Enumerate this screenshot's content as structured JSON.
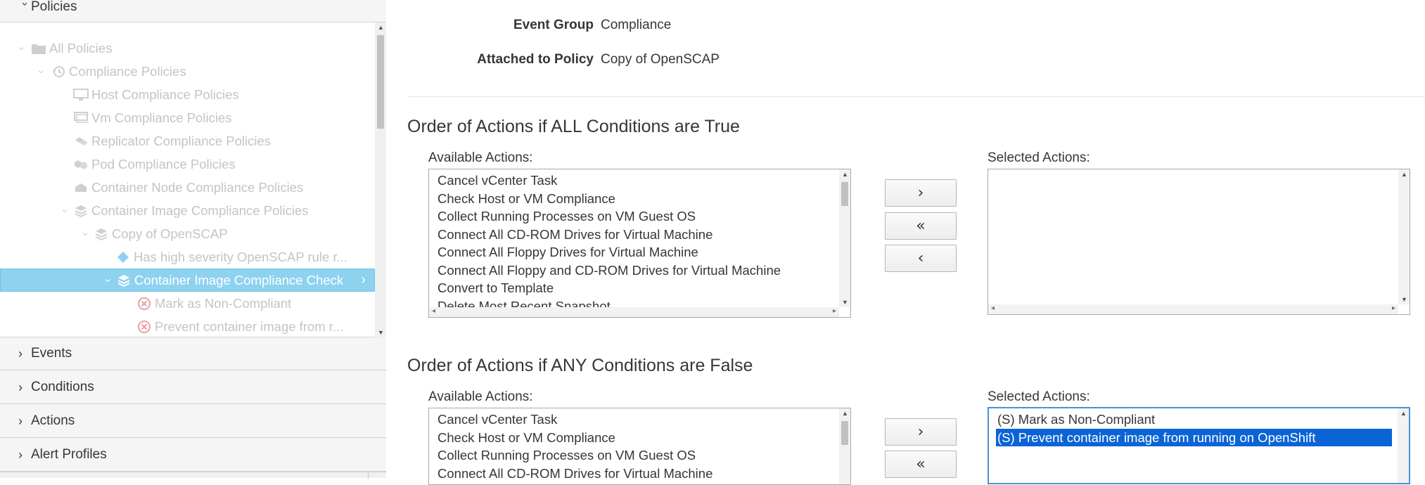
{
  "sidebar": {
    "accordion": {
      "policies": "Policies",
      "events": "Events",
      "conditions": "Conditions",
      "actions": "Actions",
      "alert_profiles": "Alert Profiles"
    },
    "tree": [
      {
        "label": "All Policies",
        "icon": "folder-icon"
      },
      {
        "label": "Compliance Policies",
        "icon": "history-icon"
      },
      {
        "label": "Host Compliance Policies",
        "icon": "monitor-icon"
      },
      {
        "label": "Vm Compliance Policies",
        "icon": "vm-icon"
      },
      {
        "label": "Replicator Compliance Policies",
        "icon": "replicator-icon"
      },
      {
        "label": "Pod Compliance Policies",
        "icon": "pod-icon"
      },
      {
        "label": "Container Node Compliance Policies",
        "icon": "node-icon"
      },
      {
        "label": "Container Image Compliance Policies",
        "icon": "image-stack-icon"
      },
      {
        "label": "Copy of OpenSCAP",
        "icon": "image-stack-icon"
      },
      {
        "label": "Has high severity OpenSCAP rule r...",
        "icon": "diamond-icon"
      },
      {
        "label": "Container Image Compliance Check",
        "icon": "image-stack-icon"
      },
      {
        "label": "Mark as Non-Compliant",
        "icon": "error-circle-icon"
      },
      {
        "label": "Prevent container image from r...",
        "icon": "error-circle-icon"
      }
    ],
    "colors": {
      "selected_bg": "#8ed2f0",
      "error_icon": "#e8a0a0",
      "diamond": "#8ed2f0"
    }
  },
  "details": {
    "event_group_label": "Event Group",
    "event_group_value": "Compliance",
    "attached_label": "Attached to Policy",
    "attached_value": "Copy of OpenSCAP"
  },
  "section_true": {
    "title": "Order of Actions if ALL Conditions are True",
    "available_label": "Available Actions:",
    "selected_label": "Selected Actions:",
    "available": [
      "Cancel vCenter Task",
      "Check Host or VM Compliance",
      "Collect Running Processes on VM Guest OS",
      "Connect All CD-ROM Drives for Virtual Machine",
      "Connect All Floppy Drives for Virtual Machine",
      "Connect All Floppy and CD-ROM Drives for Virtual Machine",
      "Convert to Template",
      "Delete Most Recent Snapshot"
    ],
    "selected": [],
    "buttons": {
      "add": "›",
      "remove_all": "«",
      "remove": "‹"
    }
  },
  "section_false": {
    "title": "Order of Actions if ANY Conditions are False",
    "available_label": "Available Actions:",
    "selected_label": "Selected Actions:",
    "available": [
      "Cancel vCenter Task",
      "Check Host or VM Compliance",
      "Collect Running Processes on VM Guest OS",
      "Connect All CD-ROM Drives for Virtual Machine"
    ],
    "selected": [
      "(S) Mark as Non-Compliant",
      "(S) Prevent container image from running on OpenShift"
    ],
    "selected_highlight_index": 1,
    "buttons": {
      "add": "›",
      "remove_all": "«"
    }
  },
  "colors": {
    "selection": "#0a64d6",
    "focus_border": "#4a90d9"
  }
}
